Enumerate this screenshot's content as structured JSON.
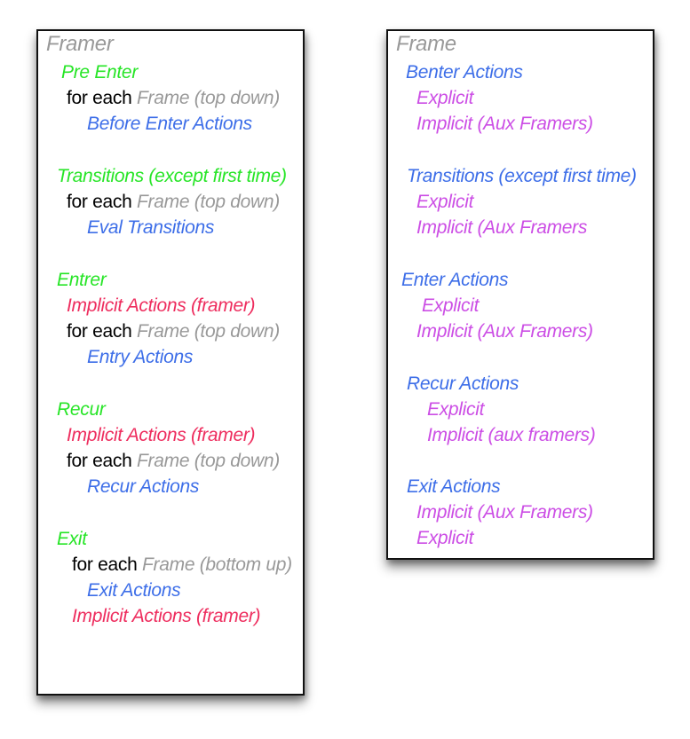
{
  "framer": {
    "title": "Framer",
    "pre_enter": {
      "heading": "Pre Enter",
      "for_each": "for each",
      "frame_order": "Frame (top down)",
      "action": "Before Enter Actions"
    },
    "transitions": {
      "heading": "Transitions (except first time)",
      "for_each": "for each",
      "frame_order": "Frame (top down)",
      "action": "Eval Transitions"
    },
    "entrer": {
      "heading": "Entrer",
      "implicit": "Implicit Actions (framer)",
      "for_each": "for each",
      "frame_order": "Frame (top down)",
      "action": "Entry Actions"
    },
    "recur": {
      "heading": "Recur",
      "implicit": "Implicit Actions (framer)",
      "for_each": "for each",
      "frame_order": "Frame (top down)",
      "action": "Recur Actions"
    },
    "exit": {
      "heading": "Exit",
      "for_each": "for each",
      "frame_order": "Frame (bottom up)",
      "action": "Exit Actions",
      "implicit": "Implicit Actions (framer)"
    }
  },
  "frame": {
    "title": "Frame",
    "benter": {
      "heading": "Benter Actions",
      "explicit": "Explicit",
      "implicit": "Implicit (Aux Framers)"
    },
    "transitions": {
      "heading": "Transitions (except first time)",
      "explicit": "Explicit",
      "implicit": "Implicit (Aux Framers"
    },
    "enter": {
      "heading": "Enter Actions",
      "explicit": "Explicit",
      "implicit": "Implicit (Aux Framers)"
    },
    "recur": {
      "heading": "Recur Actions",
      "explicit": "Explicit",
      "implicit": "Implicit (aux framers)"
    },
    "exit": {
      "heading": "Exit Actions",
      "implicit": "Implicit (Aux Framers)",
      "explicit": "Explicit"
    }
  },
  "colors": {
    "title_grey": "#999999",
    "phase_green": "#27e527",
    "loop_black": "#000000",
    "action_blue": "#3d6ee8",
    "implicit_red": "#ee2d5e",
    "explicit_magenta": "#cc4ee5"
  }
}
